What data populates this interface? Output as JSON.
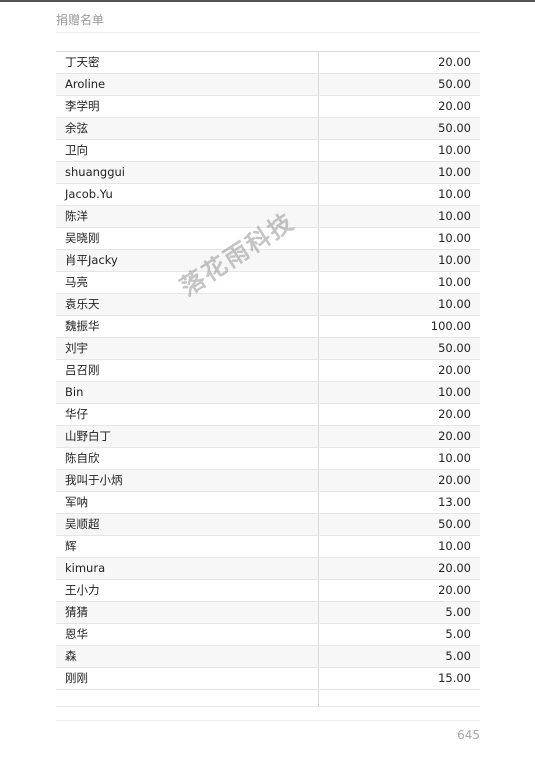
{
  "header": {
    "title": "捐赠名单"
  },
  "donors": [
    {
      "name": "丁天密",
      "amount": "20.00"
    },
    {
      "name": "Aroline",
      "amount": "50.00"
    },
    {
      "name": "李学明",
      "amount": "20.00"
    },
    {
      "name": "余弦",
      "amount": "50.00"
    },
    {
      "name": "卫向",
      "amount": "10.00"
    },
    {
      "name": "shuanggui",
      "amount": "10.00"
    },
    {
      "name": "Jacob.Yu",
      "amount": "10.00"
    },
    {
      "name": "陈洋",
      "amount": "10.00"
    },
    {
      "name": "吴晓刚",
      "amount": "10.00"
    },
    {
      "name": "肖平Jacky",
      "amount": "10.00"
    },
    {
      "name": "马亮",
      "amount": "10.00"
    },
    {
      "name": "袁乐天",
      "amount": "10.00"
    },
    {
      "name": "魏振华",
      "amount": "100.00"
    },
    {
      "name": "刘宇",
      "amount": "50.00"
    },
    {
      "name": "吕召刚",
      "amount": "20.00"
    },
    {
      "name": "Bin",
      "amount": "10.00"
    },
    {
      "name": "华仔",
      "amount": "20.00"
    },
    {
      "name": "山野白丁",
      "amount": "20.00"
    },
    {
      "name": "陈自欣",
      "amount": "10.00"
    },
    {
      "name": "我叫于小炳",
      "amount": "20.00"
    },
    {
      "name": "军呐",
      "amount": "13.00"
    },
    {
      "name": "吴顺超",
      "amount": "50.00"
    },
    {
      "name": "辉",
      "amount": "10.00"
    },
    {
      "name": "kimura",
      "amount": "20.00"
    },
    {
      "name": "王小力",
      "amount": "20.00"
    },
    {
      "name": "猜猜",
      "amount": "5.00"
    },
    {
      "name": "恩华",
      "amount": "5.00"
    },
    {
      "name": "森",
      "amount": "5.00"
    },
    {
      "name": "刚刚",
      "amount": "15.00"
    }
  ],
  "watermark": {
    "text": "落花雨科技"
  },
  "footer": {
    "page_number": "645"
  }
}
